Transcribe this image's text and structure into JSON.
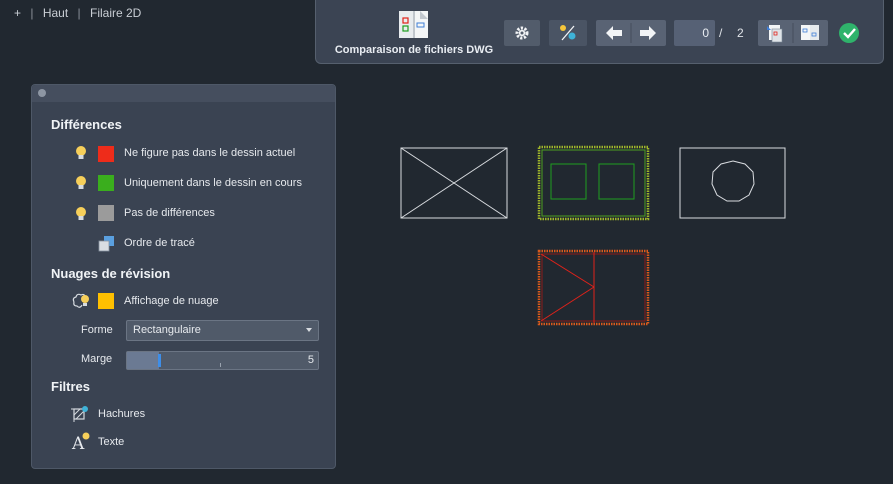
{
  "viewport": {
    "plus": "+",
    "view": "Haut",
    "style": "Filaire 2D"
  },
  "toolbar": {
    "main_label": "Comparaison de fichiers DWG",
    "current": "0",
    "separator": "/",
    "total": "2"
  },
  "palette": {
    "differences_title": "Différences",
    "items": [
      {
        "label": "Ne figure pas dans le dessin actuel",
        "color": "#ee2c1a"
      },
      {
        "label": "Uniquement dans le dessin en cours",
        "color": "#3aae1d"
      },
      {
        "label": "Pas de différences",
        "color": "#9b9b9b"
      },
      {
        "label": "Ordre de tracé"
      }
    ],
    "clouds_title": "Nuages de révision",
    "cloud_display_label": "Affichage de nuage",
    "cloud_color": "#ffc000",
    "shape_label": "Forme",
    "shape_value": "Rectangulaire",
    "margin_label": "Marge",
    "margin_value": "5",
    "margin_fraction": 0.17,
    "filters_title": "Filtres",
    "filter_hatch": "Hachures",
    "filter_text": "Texte"
  },
  "canvas": {
    "line_color": "#d9dce0",
    "changed_color": "#1f9e1f",
    "removed_color": "#e0221a",
    "green_cloud": "#7aa21f",
    "red_cloud": "#d95a1c"
  }
}
